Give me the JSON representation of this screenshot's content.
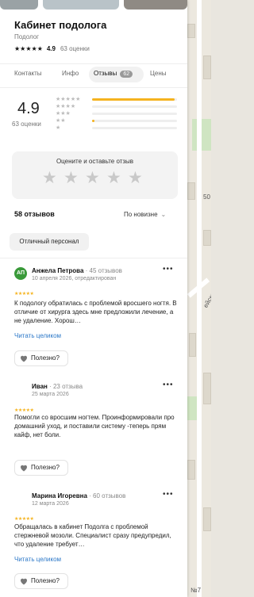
{
  "org": {
    "name": "Кабинет подолога",
    "category": "Подолог",
    "rating": "4.9",
    "rating_count": "63 оценки"
  },
  "tabs": [
    {
      "label": "Контакты"
    },
    {
      "label": "Инфо"
    },
    {
      "label": "Отзывы",
      "badge": "62",
      "active": true
    },
    {
      "label": "Цены"
    }
  ],
  "summary": {
    "rating": "4.9",
    "count": "63 оценки",
    "distribution": [
      {
        "stars": 5,
        "fraction": 0.97
      },
      {
        "stars": 4,
        "fraction": 0.0
      },
      {
        "stars": 3,
        "fraction": 0.0
      },
      {
        "stars": 2,
        "fraction": 0.03
      },
      {
        "stars": 1,
        "fraction": 0.0
      }
    ]
  },
  "rate_box": {
    "title": "Оцените и оставьте отзыв"
  },
  "reviews_header": {
    "count": "58 отзывов",
    "sort": "По новизне"
  },
  "filter_chip": "Отличный персонал",
  "reviews": [
    {
      "avatar": "АП",
      "avatar_color": "#3a9a3a",
      "name": "Анжела Петрова",
      "meta": "· 45 отзывов",
      "date": "10 апреля 2026, отредактирован",
      "rating": 5,
      "text": "К подологу обратилась с проблемой вросшего ногтя. В отличие от хирурга здесь мне предложили лечение, а не удаление. Хорош…",
      "read_more": "Читать целиком",
      "useful": "Полезно?"
    },
    {
      "avatar": "",
      "name": "Иван",
      "meta": "· 23 отзыва",
      "date": "25 марта 2026",
      "rating": 5,
      "text": "Помогли со вросшим ногтем. Проинформировали про домашний уход, и поставили систему -теперь прям кайф, нет боли.",
      "useful": "Полезно?"
    },
    {
      "avatar": "",
      "name": "Марина Игоревна",
      "meta": "· 60 отзывов",
      "date": "12 марта 2026",
      "rating": 5,
      "text": "Обращалась в кабинет Подолга с проблемой стержневой мозоли. Специалист сразу предупредил, что удаление требует…",
      "read_more": "Читать целиком",
      "useful": "Полезно?"
    }
  ],
  "map": {
    "labels": [
      "50",
      "ейская",
      "№7"
    ]
  },
  "colors": {
    "accent": "#f5b31f",
    "link": "#2c78c8",
    "avatar_green": "#3a9a3a"
  }
}
